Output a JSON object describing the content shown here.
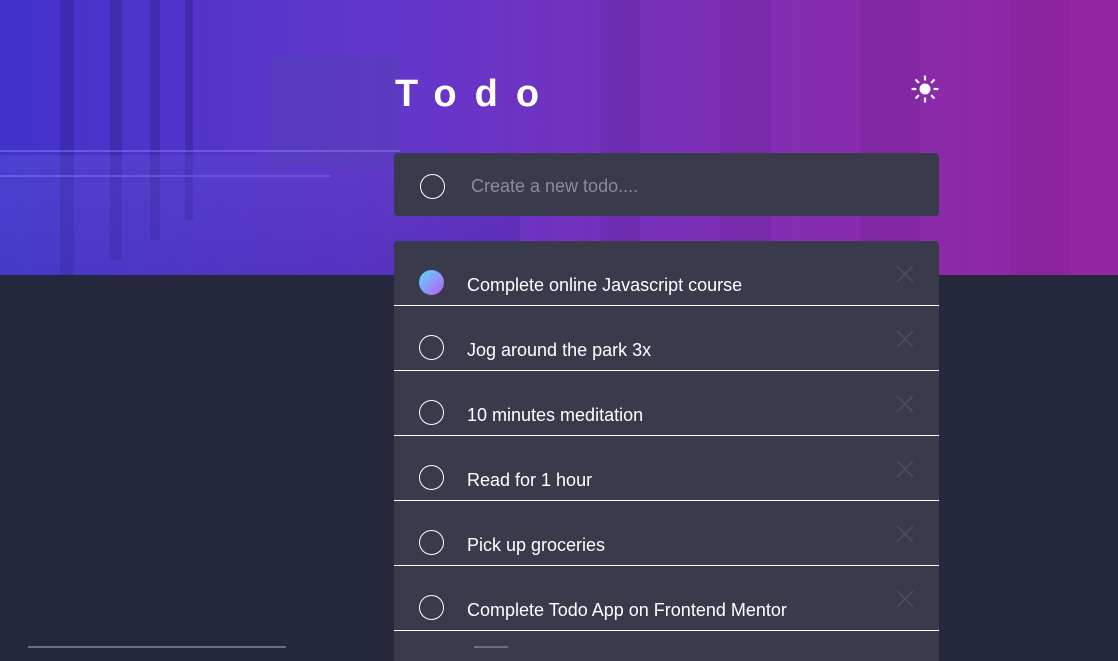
{
  "header": {
    "title": "Todo",
    "theme_toggle_icon": "sun-icon"
  },
  "new_todo": {
    "placeholder": "Create a new todo....",
    "value": ""
  },
  "todos": [
    {
      "label": "Complete online Javascript course",
      "completed": true
    },
    {
      "label": "Jog around the park 3x",
      "completed": false
    },
    {
      "label": "10 minutes meditation",
      "completed": false
    },
    {
      "label": "Read for 1 hour",
      "completed": false
    },
    {
      "label": "Pick up groceries",
      "completed": false
    },
    {
      "label": "Complete Todo App on Frontend Mentor",
      "completed": false
    }
  ],
  "colors": {
    "background": "#25273c",
    "card": "#393a4c",
    "check_gradient_start": "#57ddff",
    "check_gradient_end": "#c058f3",
    "hero_start": "#3a21b8",
    "hero_end": "#8a2496"
  }
}
